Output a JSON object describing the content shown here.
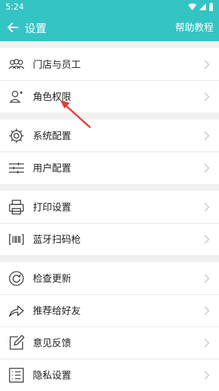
{
  "status": {
    "time": "5:24"
  },
  "appbar": {
    "title": "设置",
    "help": "帮助教程"
  },
  "groups": [
    {
      "items": [
        {
          "label": "门店与员工",
          "icon": "store-staff-icon"
        },
        {
          "label": "角色权限",
          "icon": "role-permission-icon"
        }
      ]
    },
    {
      "items": [
        {
          "label": "系统配置",
          "icon": "gear-icon"
        },
        {
          "label": "用户配置",
          "icon": "sliders-icon"
        }
      ]
    },
    {
      "items": [
        {
          "label": "打印设置",
          "icon": "printer-icon"
        },
        {
          "label": "蓝牙扫码枪",
          "icon": "barcode-icon"
        }
      ]
    },
    {
      "items": [
        {
          "label": "检查更新",
          "icon": "refresh-icon"
        },
        {
          "label": "推荐给好友",
          "icon": "share-icon"
        },
        {
          "label": "意见反馈",
          "icon": "feedback-icon"
        },
        {
          "label": "隐私设置",
          "icon": "privacy-list-icon"
        }
      ]
    }
  ],
  "colors": {
    "accent": "#34c4c4",
    "annotation": "#e53935"
  }
}
